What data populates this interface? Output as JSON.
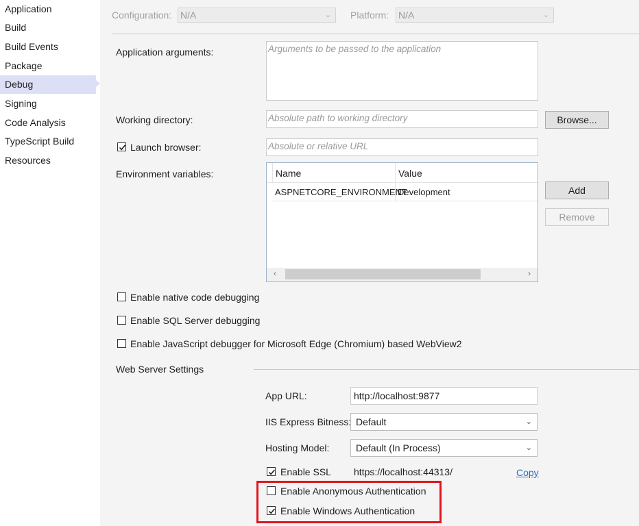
{
  "sidebar": {
    "items": [
      {
        "label": "Application",
        "active": false
      },
      {
        "label": "Build",
        "active": false
      },
      {
        "label": "Build Events",
        "active": false
      },
      {
        "label": "Package",
        "active": false
      },
      {
        "label": "Debug",
        "active": true
      },
      {
        "label": "Signing",
        "active": false
      },
      {
        "label": "Code Analysis",
        "active": false
      },
      {
        "label": "TypeScript Build",
        "active": false
      },
      {
        "label": "Resources",
        "active": false
      }
    ]
  },
  "header": {
    "configuration_label": "Configuration:",
    "configuration_value": "N/A",
    "platform_label": "Platform:",
    "platform_value": "N/A"
  },
  "debug": {
    "app_args_label": "Application arguments:",
    "app_args_placeholder": "Arguments to be passed to the application",
    "working_dir_label": "Working directory:",
    "working_dir_placeholder": "Absolute path to working directory",
    "browse_label": "Browse...",
    "launch_browser_label": "Launch browser:",
    "launch_browser_checked": true,
    "launch_url_placeholder": "Absolute or relative URL",
    "env_vars_label": "Environment variables:",
    "env_columns": [
      "Name",
      "Value"
    ],
    "env_rows": [
      {
        "name": "ASPNETCORE_ENVIRONMENT",
        "value": "Development"
      }
    ],
    "add_label": "Add",
    "remove_label": "Remove",
    "native_debug_label": "Enable native code debugging",
    "sql_debug_label": "Enable SQL Server debugging",
    "js_debug_label": "Enable JavaScript debugger for Microsoft Edge (Chromium) based WebView2"
  },
  "web_server": {
    "section_title": "Web Server Settings",
    "app_url_label": "App URL:",
    "app_url_value": "http://localhost:9877",
    "iis_bitness_label": "IIS Express Bitness:",
    "iis_bitness_value": "Default",
    "hosting_model_label": "Hosting Model:",
    "hosting_model_value": "Default (In Process)",
    "enable_ssl_label": "Enable SSL",
    "enable_ssl_checked": true,
    "ssl_url": "https://localhost:44313/",
    "copy_label": "Copy",
    "anon_auth_label": "Enable Anonymous Authentication",
    "anon_auth_checked": false,
    "windows_auth_label": "Enable Windows Authentication",
    "windows_auth_checked": true
  },
  "colors": {
    "active_nav": "#dcdff5",
    "highlight_box": "#e0141e",
    "link": "#2b6cc4"
  }
}
